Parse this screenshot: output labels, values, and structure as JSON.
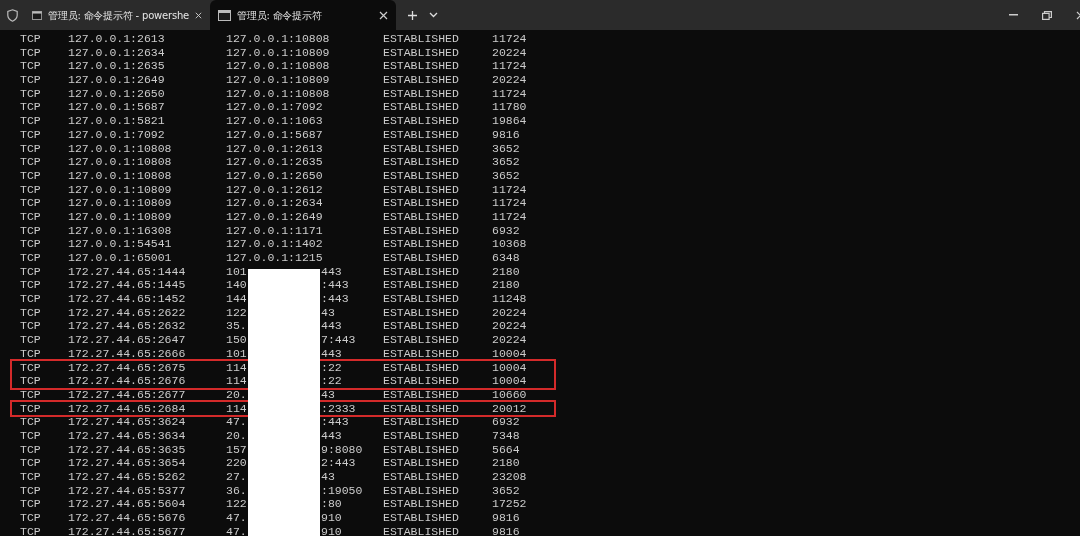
{
  "tabs": [
    {
      "title": "管理员: 命令提示符 - powershe",
      "selected": false
    },
    {
      "title": "管理员: 命令提示符",
      "selected": true
    }
  ],
  "rows": [
    {
      "proto": "TCP",
      "local": "127.0.0.1:2613",
      "foreign": [
        "127.0.0.1:10808"
      ],
      "state": "ESTABLISHED",
      "pid": "11724",
      "highlighted": false
    },
    {
      "proto": "TCP",
      "local": "127.0.0.1:2634",
      "foreign": [
        "127.0.0.1:10809"
      ],
      "state": "ESTABLISHED",
      "pid": "20224",
      "highlighted": false
    },
    {
      "proto": "TCP",
      "local": "127.0.0.1:2635",
      "foreign": [
        "127.0.0.1:10808"
      ],
      "state": "ESTABLISHED",
      "pid": "11724",
      "highlighted": false
    },
    {
      "proto": "TCP",
      "local": "127.0.0.1:2649",
      "foreign": [
        "127.0.0.1:10809"
      ],
      "state": "ESTABLISHED",
      "pid": "20224",
      "highlighted": false
    },
    {
      "proto": "TCP",
      "local": "127.0.0.1:2650",
      "foreign": [
        "127.0.0.1:10808"
      ],
      "state": "ESTABLISHED",
      "pid": "11724",
      "highlighted": false
    },
    {
      "proto": "TCP",
      "local": "127.0.0.1:5687",
      "foreign": [
        "127.0.0.1:7092"
      ],
      "state": "ESTABLISHED",
      "pid": "11780",
      "highlighted": false
    },
    {
      "proto": "TCP",
      "local": "127.0.0.1:5821",
      "foreign": [
        "127.0.0.1:1063"
      ],
      "state": "ESTABLISHED",
      "pid": "19864",
      "highlighted": false
    },
    {
      "proto": "TCP",
      "local": "127.0.0.1:7092",
      "foreign": [
        "127.0.0.1:5687"
      ],
      "state": "ESTABLISHED",
      "pid": "9816",
      "highlighted": false
    },
    {
      "proto": "TCP",
      "local": "127.0.0.1:10808",
      "foreign": [
        "127.0.0.1:2613"
      ],
      "state": "ESTABLISHED",
      "pid": "3652",
      "highlighted": false
    },
    {
      "proto": "TCP",
      "local": "127.0.0.1:10808",
      "foreign": [
        "127.0.0.1:2635"
      ],
      "state": "ESTABLISHED",
      "pid": "3652",
      "highlighted": false
    },
    {
      "proto": "TCP",
      "local": "127.0.0.1:10808",
      "foreign": [
        "127.0.0.1:2650"
      ],
      "state": "ESTABLISHED",
      "pid": "3652",
      "highlighted": false
    },
    {
      "proto": "TCP",
      "local": "127.0.0.1:10809",
      "foreign": [
        "127.0.0.1:2612"
      ],
      "state": "ESTABLISHED",
      "pid": "11724",
      "highlighted": false
    },
    {
      "proto": "TCP",
      "local": "127.0.0.1:10809",
      "foreign": [
        "127.0.0.1:2634"
      ],
      "state": "ESTABLISHED",
      "pid": "11724",
      "highlighted": false
    },
    {
      "proto": "TCP",
      "local": "127.0.0.1:10809",
      "foreign": [
        "127.0.0.1:2649"
      ],
      "state": "ESTABLISHED",
      "pid": "11724",
      "highlighted": false
    },
    {
      "proto": "TCP",
      "local": "127.0.0.1:16308",
      "foreign": [
        "127.0.0.1:1171"
      ],
      "state": "ESTABLISHED",
      "pid": "6932",
      "highlighted": false
    },
    {
      "proto": "TCP",
      "local": "127.0.0.1:54541",
      "foreign": [
        "127.0.0.1:1402"
      ],
      "state": "ESTABLISHED",
      "pid": "10368",
      "highlighted": false
    },
    {
      "proto": "TCP",
      "local": "127.0.0.1:65001",
      "foreign": [
        "127.0.0.1:1215"
      ],
      "state": "ESTABLISHED",
      "pid": "6348",
      "highlighted": false
    },
    {
      "proto": "TCP",
      "local": "172.27.44.65:1444",
      "foreign": [
        "101",
        "443"
      ],
      "state": "ESTABLISHED",
      "pid": "2180",
      "highlighted": false
    },
    {
      "proto": "TCP",
      "local": "172.27.44.65:1445",
      "foreign": [
        "140",
        ":443"
      ],
      "state": "ESTABLISHED",
      "pid": "2180",
      "highlighted": false
    },
    {
      "proto": "TCP",
      "local": "172.27.44.65:1452",
      "foreign": [
        "144",
        ":443"
      ],
      "state": "ESTABLISHED",
      "pid": "11248",
      "highlighted": false
    },
    {
      "proto": "TCP",
      "local": "172.27.44.65:2622",
      "foreign": [
        "122",
        "43"
      ],
      "state": "ESTABLISHED",
      "pid": "20224",
      "highlighted": false
    },
    {
      "proto": "TCP",
      "local": "172.27.44.65:2632",
      "foreign": [
        "35.",
        "443"
      ],
      "state": "ESTABLISHED",
      "pid": "20224",
      "highlighted": false
    },
    {
      "proto": "TCP",
      "local": "172.27.44.65:2647",
      "foreign": [
        "150",
        "7:443"
      ],
      "state": "ESTABLISHED",
      "pid": "20224",
      "highlighted": false
    },
    {
      "proto": "TCP",
      "local": "172.27.44.65:2666",
      "foreign": [
        "101",
        "443"
      ],
      "state": "ESTABLISHED",
      "pid": "10004",
      "highlighted": false
    },
    {
      "proto": "TCP",
      "local": "172.27.44.65:2675",
      "foreign": [
        "114",
        ":22"
      ],
      "state": "ESTABLISHED",
      "pid": "10004",
      "highlighted": true
    },
    {
      "proto": "TCP",
      "local": "172.27.44.65:2676",
      "foreign": [
        "114",
        ":22"
      ],
      "state": "ESTABLISHED",
      "pid": "10004",
      "highlighted": true
    },
    {
      "proto": "TCP",
      "local": "172.27.44.65:2677",
      "foreign": [
        "20.",
        "43"
      ],
      "state": "ESTABLISHED",
      "pid": "10660",
      "highlighted": false
    },
    {
      "proto": "TCP",
      "local": "172.27.44.65:2684",
      "foreign": [
        "114",
        ":2333"
      ],
      "state": "ESTABLISHED",
      "pid": "20012",
      "highlighted": true
    },
    {
      "proto": "TCP",
      "local": "172.27.44.65:3624",
      "foreign": [
        "47.",
        ":443"
      ],
      "state": "ESTABLISHED",
      "pid": "6932",
      "highlighted": false
    },
    {
      "proto": "TCP",
      "local": "172.27.44.65:3634",
      "foreign": [
        "20.",
        "443"
      ],
      "state": "ESTABLISHED",
      "pid": "7348",
      "highlighted": false
    },
    {
      "proto": "TCP",
      "local": "172.27.44.65:3635",
      "foreign": [
        "157",
        "9:8080"
      ],
      "state": "ESTABLISHED",
      "pid": "5664",
      "highlighted": false
    },
    {
      "proto": "TCP",
      "local": "172.27.44.65:3654",
      "foreign": [
        "220",
        "2:443"
      ],
      "state": "ESTABLISHED",
      "pid": "2180",
      "highlighted": false
    },
    {
      "proto": "TCP",
      "local": "172.27.44.65:5262",
      "foreign": [
        "27.",
        "43"
      ],
      "state": "ESTABLISHED",
      "pid": "23208",
      "highlighted": false
    },
    {
      "proto": "TCP",
      "local": "172.27.44.65:5377",
      "foreign": [
        "36.",
        ":19050"
      ],
      "state": "ESTABLISHED",
      "pid": "3652",
      "highlighted": false
    },
    {
      "proto": "TCP",
      "local": "172.27.44.65:5604",
      "foreign": [
        "122",
        ":80"
      ],
      "state": "ESTABLISHED",
      "pid": "17252",
      "highlighted": false
    },
    {
      "proto": "TCP",
      "local": "172.27.44.65:5676",
      "foreign": [
        "47.",
        "910"
      ],
      "state": "ESTABLISHED",
      "pid": "9816",
      "highlighted": false
    },
    {
      "proto": "TCP",
      "local": "172.27.44.65:5677",
      "foreign": [
        "47.",
        "910"
      ],
      "state": "ESTABLISHED",
      "pid": "9816",
      "highlighted": false
    }
  ]
}
